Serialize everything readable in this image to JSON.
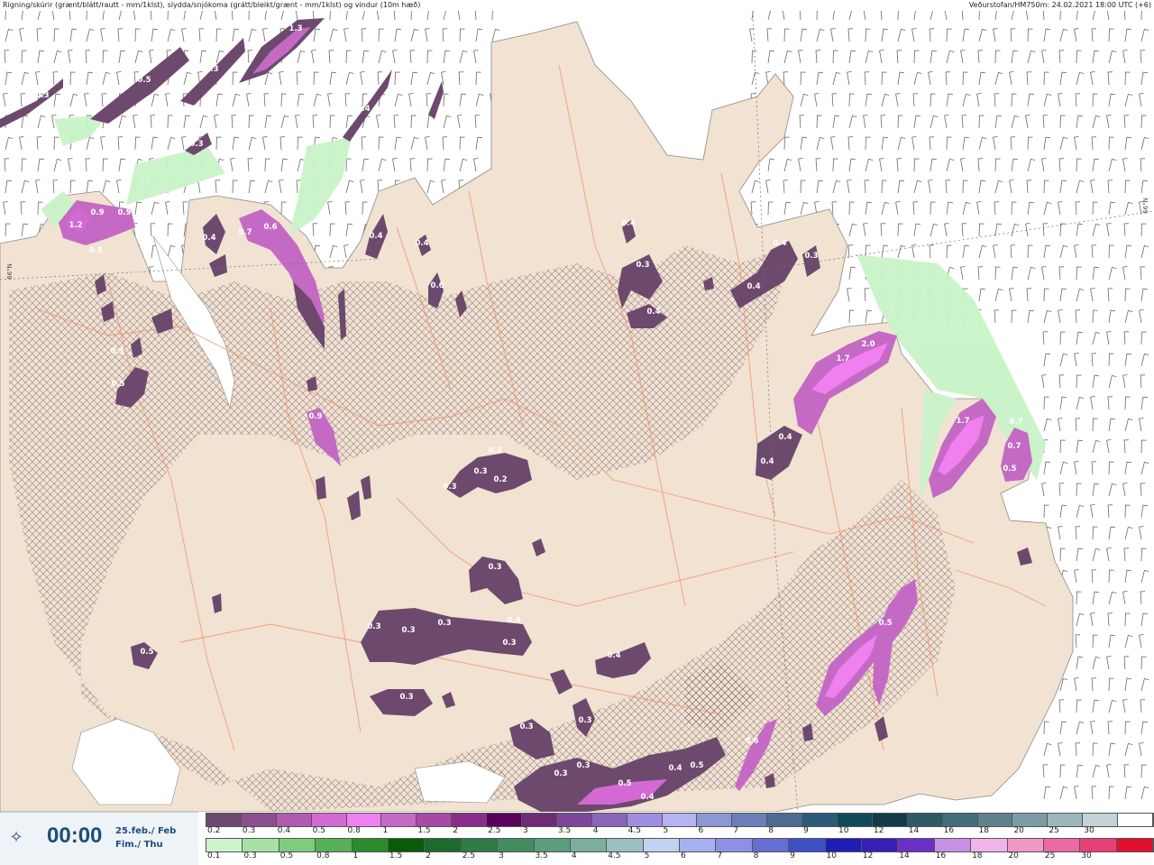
{
  "header": {
    "left": "Rigning/skúrir (grænt/blátt/rautt - mm/1klst), slydda/snjókoma (grátt/bleikt/grænt - mm/1klst) og vindur (10m hæð)",
    "right": "Veðurstofan/HM750m: 24.02.2021 18:00 UTC (+6)"
  },
  "map_labels": {
    "lat_left": "66°N",
    "lat_right": "66°N"
  },
  "colors": {
    "land": "#f1e2d2",
    "sea": "#ffffff",
    "roads": "#f0926a",
    "hatch": "#6c5560",
    "rain_green": "#c9f3c8"
  },
  "precip_labels": [
    "1.3",
    "0.5",
    "0.3",
    "0.3",
    "0.4",
    "0.3",
    "1.2",
    "0.9",
    "0.9",
    "0.3",
    "0.7",
    "0.6",
    "0.4",
    "0.4",
    "0.4",
    "0.6",
    "0.4",
    "0.3",
    "0.4",
    "0.4",
    "0.3",
    "0.4",
    "2.0",
    "1.7",
    "0.4",
    "0.4",
    "0.7",
    "1.7",
    "0.7",
    "0.5",
    "0.9",
    "0.5",
    "0.3",
    "0.3",
    "0.3",
    "0.2",
    "0.3",
    "0.3",
    "0.3",
    "0.3",
    "0.3",
    "0.4",
    "0.3",
    "0.5",
    "0.4",
    "0.3",
    "0.3",
    "0.3",
    "0.3",
    "0.3",
    "0.5",
    "0.4",
    "0.4",
    "0.5",
    "0.5",
    "0.6"
  ],
  "time": {
    "clock": "00:00",
    "date_line1": "25.feb./ Feb",
    "date_line2": "Fim./ Thu"
  },
  "legend_snow": {
    "labels": [
      "0.2",
      "0.3",
      "0.4",
      "0.5",
      "0.8",
      "1",
      "1.5",
      "2",
      "2.5",
      "3",
      "3.5",
      "4",
      "4.5",
      "5",
      "6",
      "7",
      "8",
      "9",
      "10",
      "12",
      "14",
      "16",
      "18",
      "20",
      "25",
      "30"
    ],
    "colors": [
      "#6d4a6d",
      "#8d4e8d",
      "#b05ab0",
      "#d36ad3",
      "#f07ff0",
      "#c46ac4",
      "#a64aa6",
      "#8a2d8a",
      "#5a005a",
      "#6e2b76",
      "#7e479c",
      "#8a66b8",
      "#9f8ee0",
      "#b5b3f0",
      "#8c97d4",
      "#6a7fb8",
      "#4e6b94",
      "#2d5a78",
      "#0e4a5c",
      "#133c48",
      "#2e5a64",
      "#446e78",
      "#5d828c",
      "#7c9ba4",
      "#9db6bc",
      "#c3d3d6",
      "#ffffff"
    ]
  },
  "legend_rain": {
    "labels": [
      "0.1",
      "0.3",
      "0.5",
      "0.8",
      "1",
      "1.5",
      "2",
      "2.5",
      "3",
      "3.5",
      "4",
      "4.5",
      "5",
      "6",
      "7",
      "8",
      "9",
      "10",
      "12",
      "14",
      "16",
      "18",
      "20",
      "25",
      "30"
    ],
    "colors": [
      "#ccf5cc",
      "#a6e2a6",
      "#7fcc7f",
      "#56b056",
      "#2c8c2c",
      "#0a5a0a",
      "#1d6b2c",
      "#2f7c46",
      "#428c60",
      "#5a9e7e",
      "#7aafa0",
      "#9bbfc2",
      "#c3d2f0",
      "#a6b1f2",
      "#8d91e4",
      "#6670d4",
      "#3f4fc4",
      "#1e1eb4",
      "#3a1eb4",
      "#6a30c8",
      "#c890e4",
      "#f0b4e8",
      "#f098c8",
      "#ec6aa4",
      "#e84074",
      "#e0102e"
    ]
  }
}
